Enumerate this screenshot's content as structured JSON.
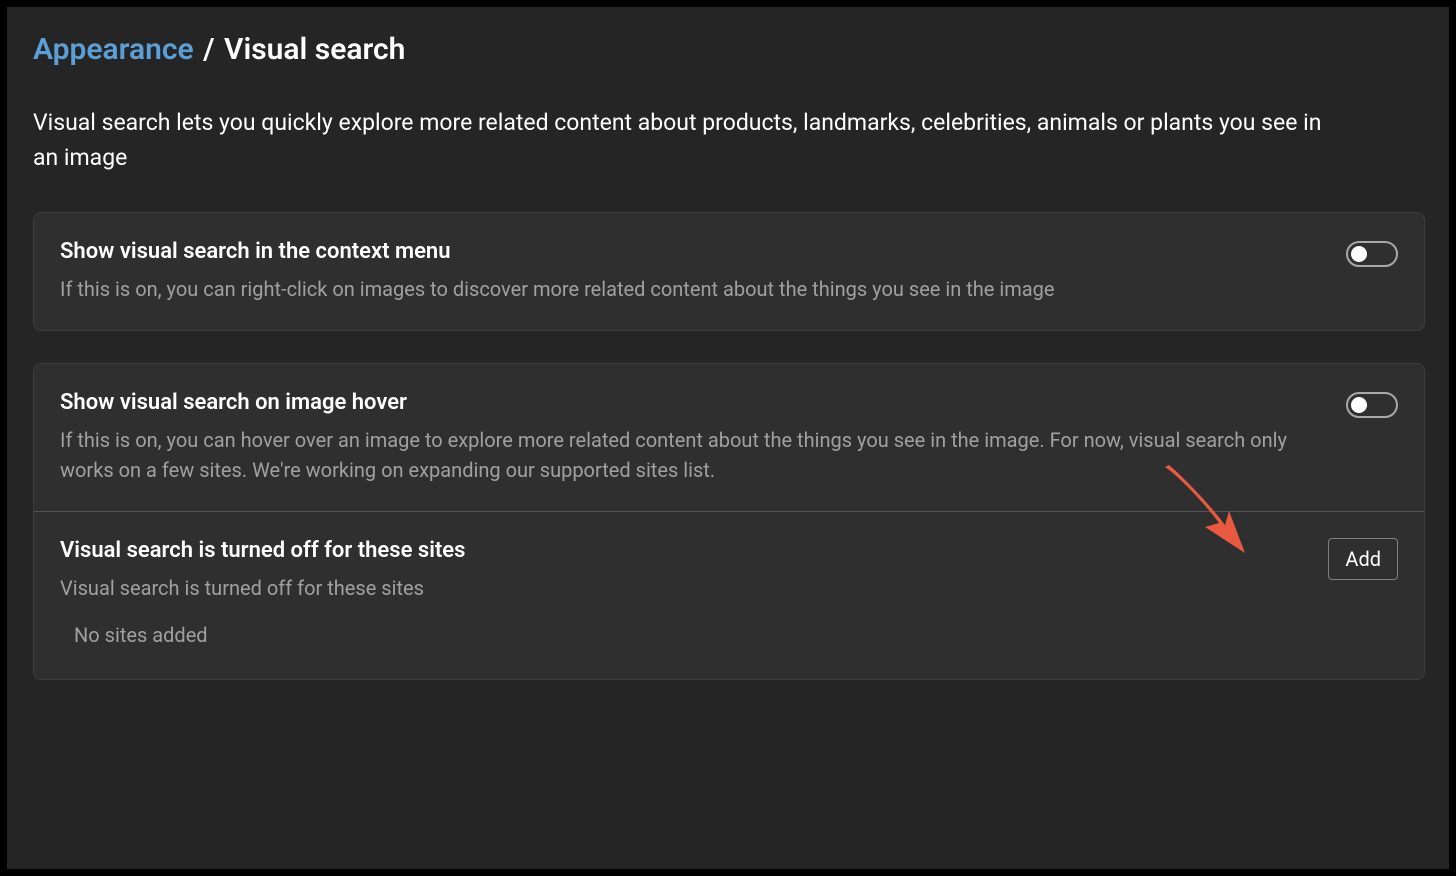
{
  "breadcrumb": {
    "parent": "Appearance",
    "separator": "/",
    "current": "Visual search"
  },
  "intro": "Visual search lets you quickly explore more related content about products, landmarks, celebrities, animals or plants you see in an image",
  "cards": {
    "contextMenu": {
      "title": "Show visual search in the context menu",
      "sub": "If this is on, you can right-click on images to discover more related content about the things you see in the image",
      "toggleState": "off"
    },
    "hover": {
      "title": "Show visual search on image hover",
      "sub": "If this is on, you can hover over an image to explore more related content about the things you see in the image. For now, visual search only works on a few sites. We're working on expanding our supported sites list.",
      "toggleState": "off"
    },
    "blocklist": {
      "title": "Visual search is turned off for these sites",
      "sub": "Visual search is turned off for these sites",
      "addLabel": "Add",
      "emptyLabel": "No sites added"
    }
  },
  "annotation": {
    "arrowColor": "#e8593f"
  }
}
